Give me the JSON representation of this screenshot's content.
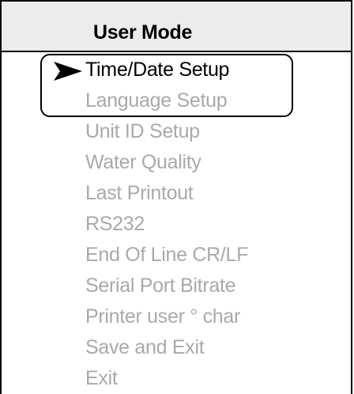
{
  "header": {
    "title": "User Mode"
  },
  "menu": {
    "items": [
      {
        "label": "Time/Date Setup",
        "selected": true
      },
      {
        "label": "Language Setup",
        "selected": false
      },
      {
        "label": "Unit ID Setup",
        "selected": false
      },
      {
        "label": "Water Quality",
        "selected": false
      },
      {
        "label": "Last Printout",
        "selected": false
      },
      {
        "label": "RS232",
        "selected": false
      },
      {
        "label": "End Of Line CR/LF",
        "selected": false
      },
      {
        "label": "Serial Port Bitrate",
        "selected": false
      },
      {
        "label": "Printer user ° char",
        "selected": false
      },
      {
        "label": "Save and Exit",
        "selected": false
      },
      {
        "label": "Exit",
        "selected": false
      }
    ]
  },
  "colors": {
    "header_bg": "#ececec",
    "active_text": "#000000",
    "inactive_text": "#a9a9a9"
  },
  "icons": {
    "selection": "arrow-right-icon"
  }
}
